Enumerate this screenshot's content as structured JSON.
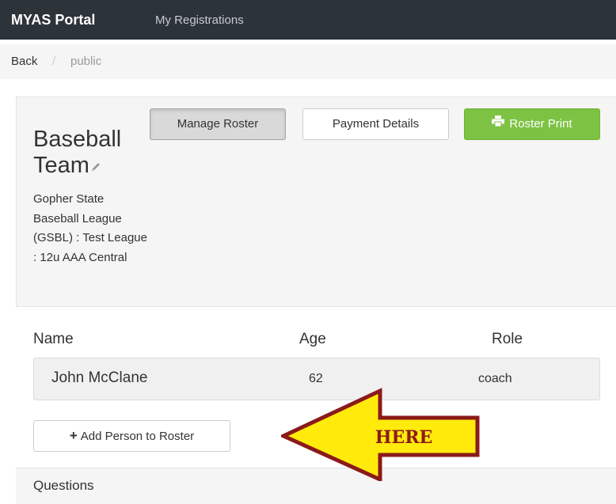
{
  "navbar": {
    "brand": "MYAS Portal",
    "link_registrations": "My Registrations"
  },
  "breadcrumb": {
    "back": "Back",
    "separator": "/",
    "current": "public"
  },
  "team": {
    "title": "Baseball Team",
    "description": "Gopher State Baseball League (GSBL) : Test League : 12u AAA Central"
  },
  "toolbar": {
    "manage_roster": "Manage Roster",
    "payment_details": "Payment Details",
    "roster_print": "Roster Print"
  },
  "roster": {
    "headers": {
      "name": "Name",
      "age": "Age",
      "role": "Role"
    },
    "rows": [
      {
        "name": "John McClane",
        "age": "62",
        "role": "coach"
      }
    ],
    "add_button": "Add Person to Roster"
  },
  "questions": {
    "title": "Questions"
  },
  "annotation": {
    "label": "HERE"
  },
  "colors": {
    "navbar": "#2c3339",
    "print_button": "#7dc243",
    "arrow_fill": "#ffeb0b",
    "arrow_outline": "#8b1a1a"
  },
  "icons": {
    "print": "printer-icon",
    "edit": "pencil-icon",
    "add": "plus-icon"
  }
}
